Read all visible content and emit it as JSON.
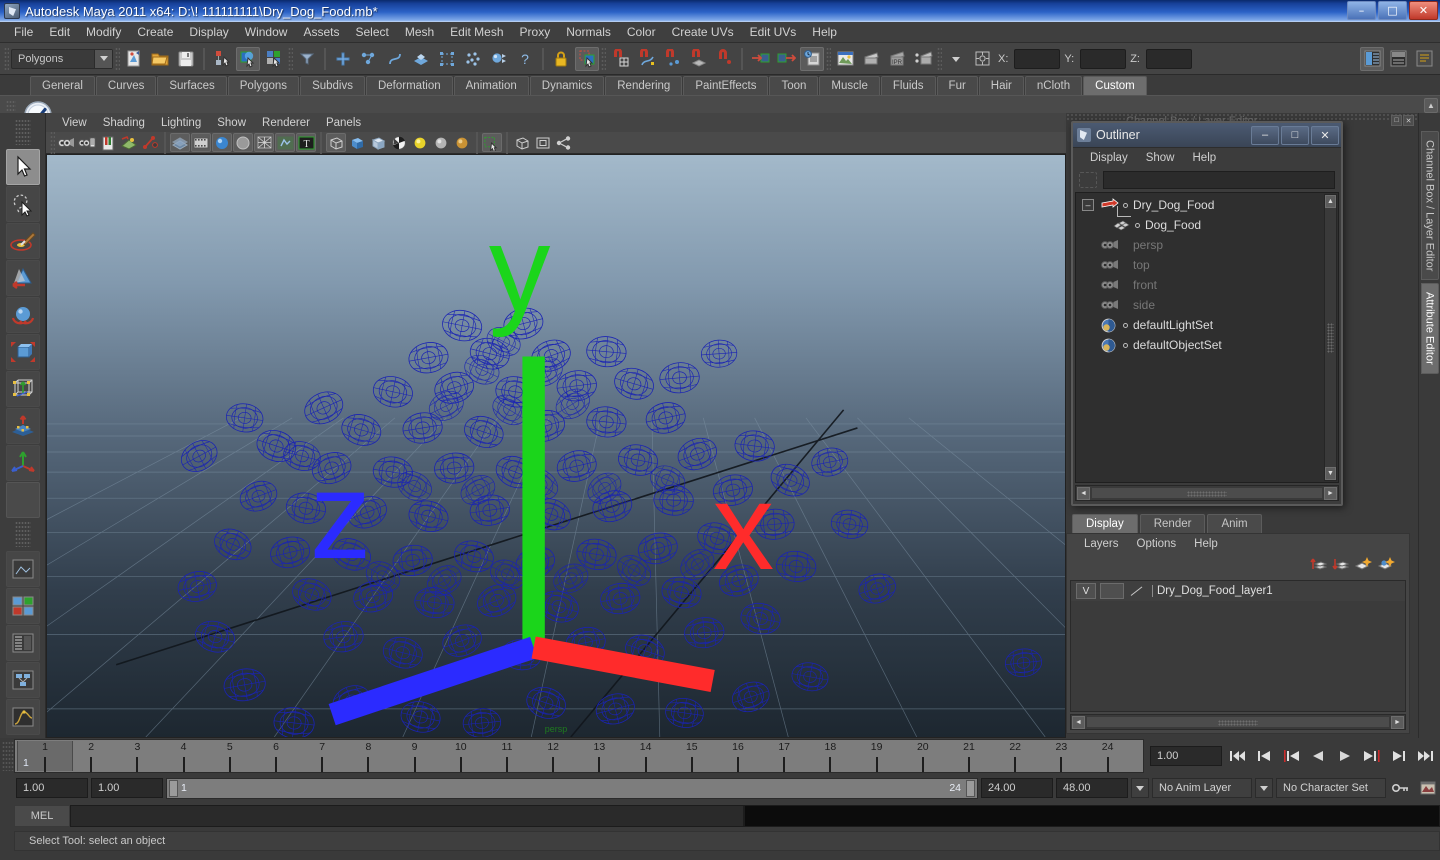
{
  "window": {
    "title": "Autodesk Maya 2011 x64: D:\\! 111111111\\Dry_Dog_Food.mb*",
    "minimize": "–",
    "maximize": "□",
    "close": "✕"
  },
  "menubar": {
    "items": [
      "File",
      "Edit",
      "Modify",
      "Create",
      "Display",
      "Window",
      "Assets",
      "Select",
      "Mesh",
      "Edit Mesh",
      "Proxy",
      "Normals",
      "Color",
      "Create UVs",
      "Edit UVs",
      "Help"
    ]
  },
  "toolbar": {
    "menuset": "Polygons",
    "coords": {
      "x_label": "X:",
      "y_label": "Y:",
      "z_label": "Z:",
      "x_value": "",
      "y_value": "",
      "z_value": ""
    },
    "icons": [
      "new-scene-icon",
      "open-scene-icon",
      "save-scene-icon",
      "undo-icon",
      "redo-icon",
      "select-by-hierarchy-icon",
      "select-by-object-icon",
      "select-by-component-icon",
      "select-all-icon",
      "select-by-handle-icon",
      "select-by-curve-icon",
      "select-by-face-icon",
      "select-by-point-icon",
      "select-by-vertex-icon",
      "select-help-icon",
      "lock-icon",
      "snap-to-grid-icon",
      "snap-to-curve-icon",
      "snap-to-point-icon",
      "snap-to-projected-center-icon",
      "snap-to-view-plane-icon",
      "input-connections-icon",
      "output-connections-icon",
      "construction-history-icon",
      "render-current-frame-icon",
      "ipr-render-icon",
      "render-settings-icon",
      "render-globals-icon",
      "field-chooser-icon"
    ]
  },
  "shelf": {
    "tabs": [
      "General",
      "Curves",
      "Surfaces",
      "Polygons",
      "Subdivs",
      "Deformation",
      "Animation",
      "Dynamics",
      "Rendering",
      "PaintEffects",
      "Toon",
      "Muscle",
      "Fluids",
      "Fur",
      "Hair",
      "nCloth",
      "Custom"
    ],
    "active_tab": "Custom",
    "items": [
      "checkmark-shelf-icon"
    ],
    "scroll_up": "▲",
    "scroll_down": "▼"
  },
  "toolbox": {
    "tools": [
      {
        "name": "select-tool",
        "selected": true
      },
      {
        "name": "lasso-select-tool",
        "selected": false
      },
      {
        "name": "paint-select-tool",
        "selected": false
      },
      {
        "name": "move-tool",
        "selected": false
      },
      {
        "name": "rotate-tool",
        "selected": false
      },
      {
        "name": "scale-tool",
        "selected": false
      },
      {
        "name": "universal-manipulator-tool",
        "selected": false
      },
      {
        "name": "soft-modification-tool",
        "selected": false
      },
      {
        "name": "last-tool-used",
        "selected": false
      },
      {
        "name": "blank-tool-slot",
        "selected": false
      }
    ],
    "layout_tools": [
      "single-perspective-layout-icon",
      "four-view-layout-icon",
      "outliner-persp-layout-icon",
      "hypergraph-layout-icon",
      "persp-graph-layout-icon"
    ]
  },
  "viewport": {
    "menus": [
      "View",
      "Shading",
      "Lighting",
      "Show",
      "Renderer",
      "Panels"
    ],
    "toolbar_icons": [
      "select-camera-icon",
      "camera-attributes-icon",
      "bookmark-icon",
      "image-plane-icon",
      "twopoint-resolution-icon",
      "grid-display-icon",
      "film-gate-icon",
      "resolution-gate-icon",
      "gate-mask-icon",
      "xray-icon",
      "wireframe-on-shaded-icon",
      "texture-icon",
      "wireframe-icon",
      "smooth-shade-all-icon",
      "shade-all-icon",
      "hardware-texturing-icon",
      "use-default-light-icon",
      "use-all-lights-icon",
      "shadows-icon",
      "isolate-select-icon",
      "xray-joints-icon",
      "exposure-icon",
      "panel-share-icon"
    ],
    "camera_label": "persp",
    "axis": {
      "x": "x",
      "y": "y",
      "z": "z"
    }
  },
  "outliner": {
    "title": "Outliner",
    "window_buttons": {
      "minimize": "–",
      "maximize": "□",
      "close": "✕"
    },
    "menus": [
      "Display",
      "Show",
      "Help"
    ],
    "search_value": "",
    "items": [
      {
        "label": "Dry_Dog_Food",
        "dim": false,
        "indent": 0,
        "expander": "–",
        "icon": "transform-node-icon"
      },
      {
        "label": "Dog_Food",
        "dim": false,
        "indent": 1,
        "expander": "",
        "icon": "mesh-node-icon"
      },
      {
        "label": "persp",
        "dim": true,
        "indent": 0,
        "expander": "",
        "icon": "camera-icon"
      },
      {
        "label": "top",
        "dim": true,
        "indent": 0,
        "expander": "",
        "icon": "camera-icon"
      },
      {
        "label": "front",
        "dim": true,
        "indent": 0,
        "expander": "",
        "icon": "camera-icon"
      },
      {
        "label": "side",
        "dim": true,
        "indent": 0,
        "expander": "",
        "icon": "camera-icon"
      },
      {
        "label": "defaultLightSet",
        "dim": false,
        "indent": 0,
        "expander": "",
        "icon": "set-icon"
      },
      {
        "label": "defaultObjectSet",
        "dim": false,
        "indent": 0,
        "expander": "",
        "icon": "set-icon"
      }
    ],
    "scroll_up": "▲",
    "scroll_down": "▼",
    "scroll_left": "◄",
    "scroll_right": "►"
  },
  "channel_box_ghost_label": "Channel Box / Layer Editor",
  "layer_editor": {
    "tabs": [
      "Display",
      "Render",
      "Anim"
    ],
    "active_tab": "Display",
    "menus": [
      "Layers",
      "Options",
      "Help"
    ],
    "toolbar_icons": [
      "move-layer-up-icon",
      "move-layer-down-icon",
      "new-empty-layer-icon",
      "new-layer-from-selected-icon"
    ],
    "layers": [
      {
        "visibility": "V",
        "color": "",
        "shading": "",
        "name": "Dry_Dog_Food_layer1"
      }
    ],
    "scroll_left": "◄",
    "scroll_right": "►"
  },
  "right_tabs": {
    "items": [
      "Channel Box / Layer Editor",
      "Attribute Editor"
    ],
    "active": "Attribute Editor"
  },
  "timeline": {
    "ticks": [
      "1",
      "2",
      "3",
      "4",
      "5",
      "6",
      "7",
      "8",
      "9",
      "10",
      "11",
      "12",
      "13",
      "14",
      "15",
      "16",
      "17",
      "18",
      "19",
      "20",
      "21",
      "22",
      "23",
      "24"
    ],
    "current_frame_marker": "1",
    "current_frame_field": "1.00",
    "playback_buttons": [
      "go-to-start-icon",
      "step-back-frame-icon",
      "step-back-key-icon",
      "play-backwards-icon",
      "play-forwards-icon",
      "step-forward-key-icon",
      "step-forward-frame-icon",
      "go-to-end-icon"
    ]
  },
  "range_slider": {
    "anim_start": "1.00",
    "range_start": "1.00",
    "range_bar_start": "1",
    "range_bar_end": "24",
    "range_end": "24.00",
    "anim_end": "48.00",
    "anim_layer": "No Anim Layer",
    "character_set": "No Character Set",
    "auto_key_icon": "auto-keyframe-icon",
    "anim_prefs_icon": "animation-preferences-icon"
  },
  "command_line": {
    "language": "MEL",
    "input_value": ""
  },
  "status_bar": {
    "message": "Select Tool: select an object"
  },
  "colors": {
    "title_bar_blue": "#2c63c7",
    "wireframe_blue": "#1a1f9e",
    "accent_green": "#1f7a1f",
    "panel_bg": "#3a3a3a"
  }
}
